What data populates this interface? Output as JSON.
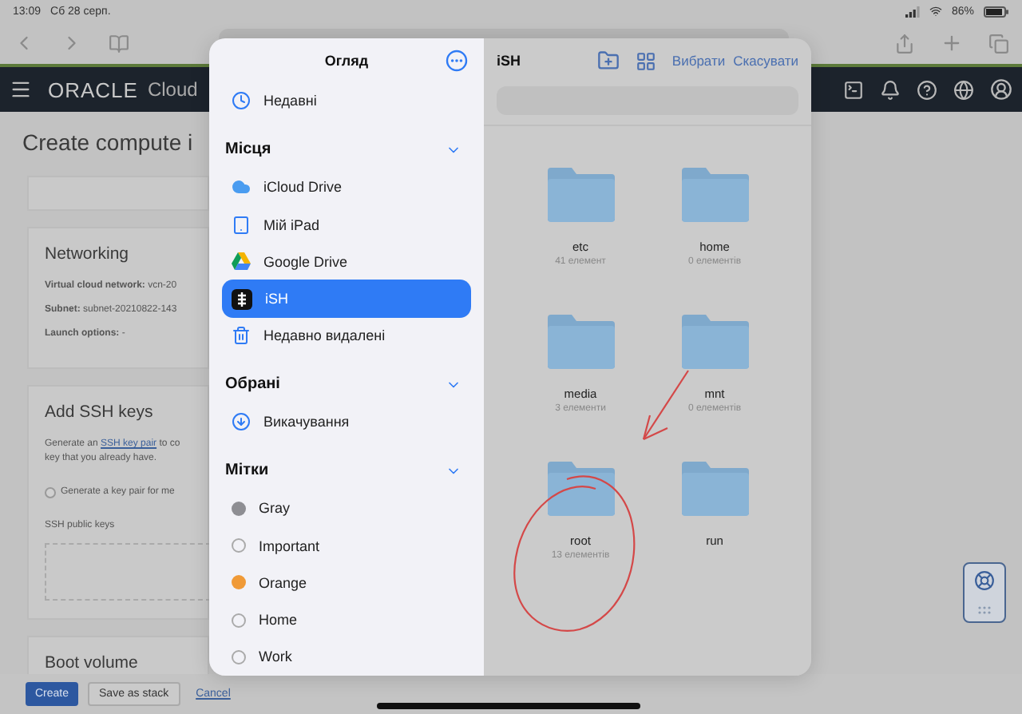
{
  "status_bar": {
    "time": "13:09",
    "date": "Сб 28 серп.",
    "battery": "86%"
  },
  "oracle_header": {
    "brand": "ORACLE",
    "product": "Cloud"
  },
  "page": {
    "title": "Create compute i",
    "networking": {
      "title": "Networking",
      "fields": [
        {
          "label": "Virtual cloud network:",
          "value": "vcn-20"
        },
        {
          "label": "Subnet:",
          "value": "subnet-20210822-143"
        },
        {
          "label": "Launch options:",
          "value": "-"
        }
      ]
    },
    "ssh": {
      "title": "Add SSH keys",
      "text_before": "Generate an",
      "link": "SSH key pair",
      "text_after": "to co",
      "text_line2": "key that you already have.",
      "radio": {
        "label": "Generate a key pair for me",
        "selected": false
      },
      "field_label": "SSH public keys"
    },
    "boot": {
      "title": "Boot volume"
    },
    "actions": {
      "create": "Create",
      "save": "Save as stack",
      "cancel": "Cancel"
    }
  },
  "picker": {
    "sidebar": {
      "title": "Огляд",
      "top_items": [
        {
          "label": "Недавні",
          "kind": "place",
          "selected": false
        }
      ],
      "sections": [
        {
          "title": "Місця",
          "expanded": true,
          "items": [
            {
              "label": "iCloud Drive",
              "kind": "place",
              "selected": false
            },
            {
              "label": "Мій iPad",
              "kind": "place",
              "selected": false
            },
            {
              "label": "Google Drive",
              "kind": "place",
              "selected": false
            },
            {
              "label": "iSH",
              "kind": "place",
              "selected": true
            },
            {
              "label": "Недавно видалені",
              "kind": "place",
              "selected": false
            }
          ]
        },
        {
          "title": "Обрані",
          "expanded": true,
          "items": [
            {
              "label": "Викачування",
              "kind": "place",
              "selected": false
            }
          ]
        },
        {
          "title": "Мітки",
          "expanded": true,
          "items": [
            {
              "label": "Gray",
              "kind": "tag",
              "color": "#8e8e93",
              "selected": false
            },
            {
              "label": "Important",
              "kind": "tag",
              "selected": false
            },
            {
              "label": "Orange",
              "kind": "tag",
              "color": "#f09a37",
              "selected": false
            },
            {
              "label": "Home",
              "kind": "tag",
              "selected": false
            },
            {
              "label": "Work",
              "kind": "tag",
              "selected": false
            }
          ]
        }
      ]
    },
    "content": {
      "title": "iSH",
      "select": "Вибрати",
      "cancel": "Скасувати",
      "folders": [
        {
          "name": "etc",
          "count": "41 елемент"
        },
        {
          "name": "home",
          "count": "0 елементів"
        },
        {
          "name": "media",
          "count": "3 елементи"
        },
        {
          "name": "mnt",
          "count": "0 елементів"
        },
        {
          "name": "root",
          "count": "13 елементів"
        },
        {
          "name": "run"
        }
      ]
    }
  }
}
